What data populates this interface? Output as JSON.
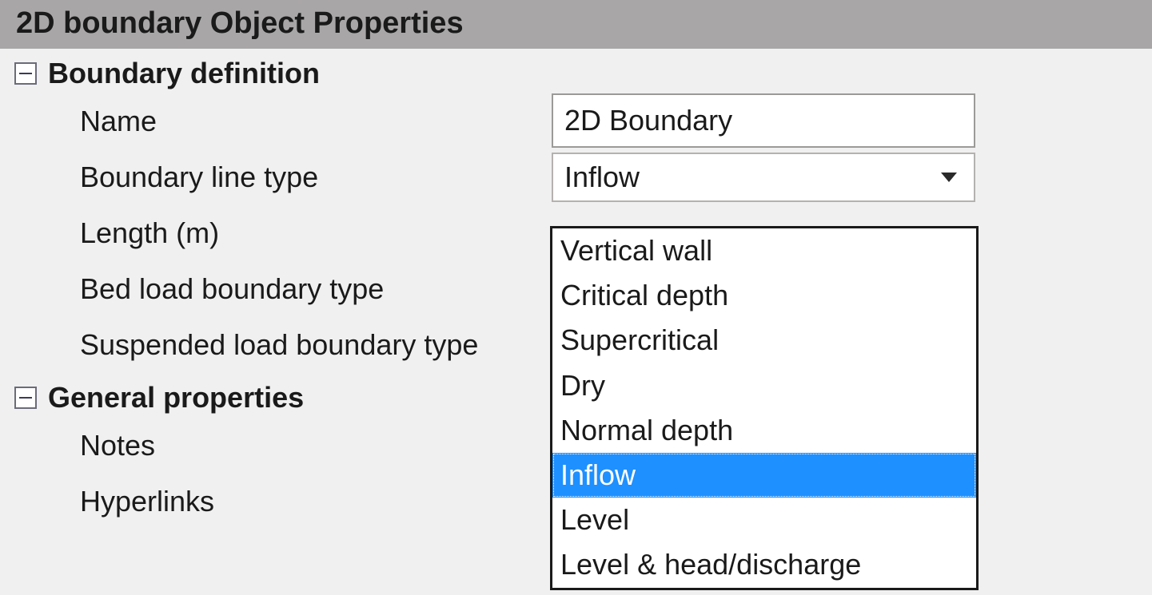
{
  "panel": {
    "title": "2D boundary Object Properties"
  },
  "sections": {
    "boundary_definition": {
      "title": "Boundary definition",
      "rows": {
        "name": {
          "label": "Name",
          "value": "2D Boundary"
        },
        "boundary_line_type": {
          "label": "Boundary line type",
          "value": "Inflow"
        },
        "length": {
          "label": "Length (m)"
        },
        "bed_load_boundary_type": {
          "label": "Bed load boundary type"
        },
        "suspended_load_boundary_type": {
          "label": "Suspended load boundary type"
        }
      }
    },
    "general_properties": {
      "title": "General properties",
      "rows": {
        "notes": {
          "label": "Notes"
        },
        "hyperlinks": {
          "label": "Hyperlinks"
        }
      }
    }
  },
  "dropdown": {
    "options": [
      "Vertical wall",
      "Critical depth",
      "Supercritical",
      "Dry",
      "Normal depth",
      "Inflow",
      "Level",
      "Level & head/discharge"
    ],
    "selected": "Inflow"
  }
}
